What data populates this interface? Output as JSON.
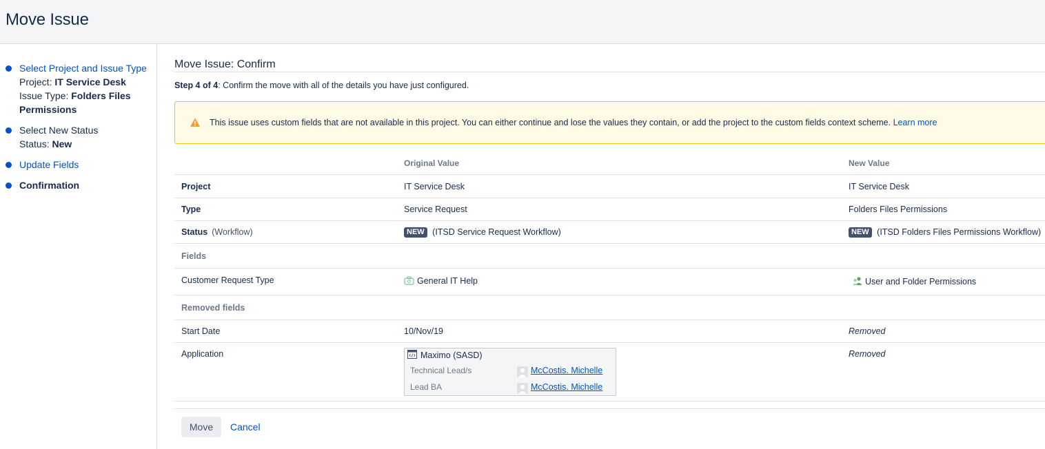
{
  "page": {
    "title": "Move Issue"
  },
  "sidebar": {
    "step1": {
      "label": "Select Project and Issue Type",
      "project_key": "Project:",
      "project_val": "IT Service Desk",
      "type_key": "Issue Type:",
      "type_val_line1": "Folders Files",
      "type_val_line2": "Permissions"
    },
    "step2": {
      "label": "Select New Status",
      "status_key": "Status:",
      "status_val": "New"
    },
    "step3": {
      "label": "Update Fields"
    },
    "step4": {
      "label": "Confirmation"
    }
  },
  "main": {
    "heading": "Move Issue: Confirm",
    "step_bold": "Step 4 of 4",
    "step_text": ": Confirm the move with all of the details you have just configured.",
    "warning": {
      "text": "This issue uses custom fields that are not available in this project. You can either continue and lose the values they contain, or add the project to the custom fields context scheme.",
      "link": "Learn more"
    },
    "table": {
      "col_original": "Original Value",
      "col_new": "New Value",
      "rows": {
        "project": {
          "label": "Project",
          "original": "IT Service Desk",
          "new": "IT Service Desk"
        },
        "type": {
          "label": "Type",
          "original": "Service Request",
          "new": "Folders Files Permissions"
        },
        "status": {
          "label": "Status",
          "workflow": "(Workflow)",
          "original_badge": "NEW",
          "original": "(ITSD Service Request Workflow)",
          "new_badge": "NEW",
          "new": "(ITSD Folders Files Permissions Workflow)"
        }
      },
      "fields_section": "Fields",
      "fields": {
        "crt": {
          "label": "Customer Request Type",
          "original": "General IT Help",
          "new": "User and Folder Permissions"
        }
      },
      "removed_section": "Removed fields",
      "removed": {
        "start_date": {
          "label": "Start Date",
          "original": "10/Nov/19",
          "new": "Removed"
        },
        "application": {
          "label": "Application",
          "new": "Removed",
          "card": {
            "title": "Maximo (SASD)",
            "tech_label": "Technical Lead/s",
            "tech_user": "McCostis. Michelle",
            "ba_label": "Lead BA",
            "ba_user": "McCostis. Michelle"
          }
        }
      }
    },
    "actions": {
      "move": "Move",
      "cancel": "Cancel"
    }
  },
  "colors": {
    "link": "#0052cc",
    "text": "#172b4d",
    "muted": "#6b778c",
    "warning_border": "#ffc400",
    "warning_bg": "#fffae6",
    "lozenge": "#42526e"
  }
}
